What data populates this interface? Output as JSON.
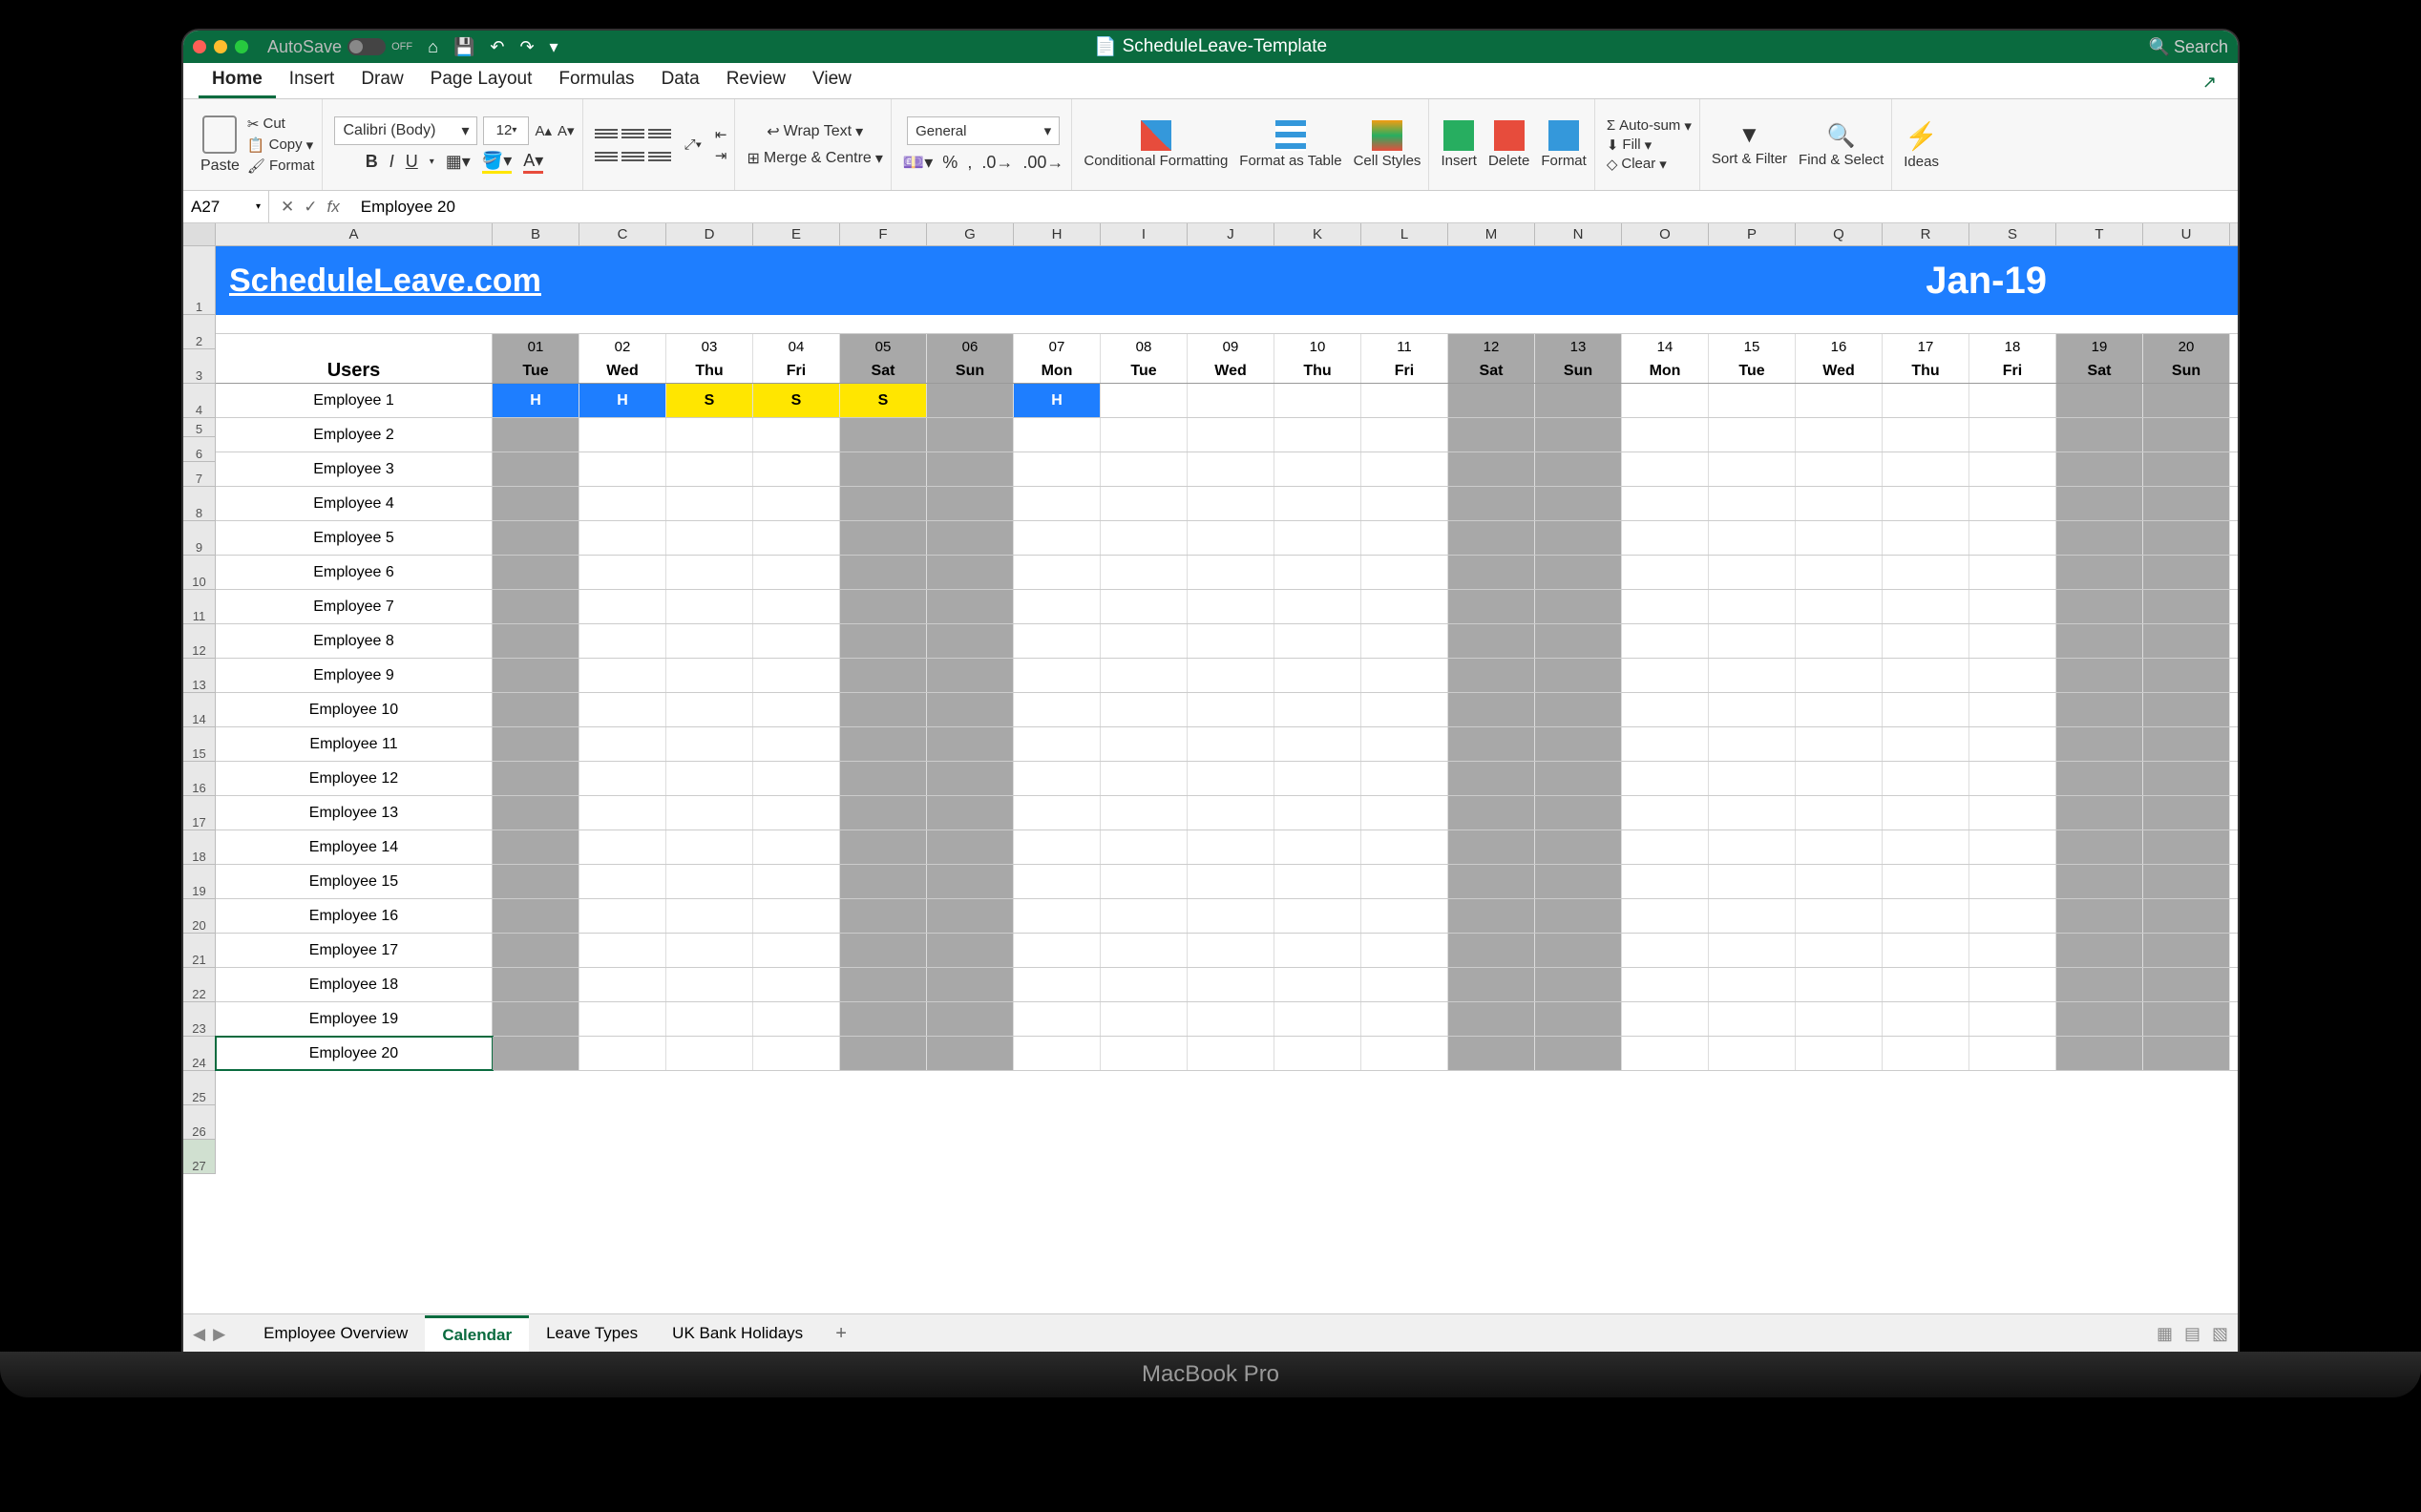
{
  "titlebar": {
    "autosave": "AutoSave",
    "autosave_state": "OFF",
    "doc": "ScheduleLeave-Template",
    "search": "Search"
  },
  "tabs": [
    "Home",
    "Insert",
    "Draw",
    "Page Layout",
    "Formulas",
    "Data",
    "Review",
    "View"
  ],
  "ribbon": {
    "paste": "Paste",
    "cut": "Cut",
    "copy": "Copy",
    "format": "Format",
    "font": "Calibri (Body)",
    "size": "12",
    "wrap": "Wrap Text",
    "merge": "Merge & Centre",
    "numfmt": "General",
    "cf": "Conditional Formatting",
    "fat": "Format as Table",
    "cs": "Cell Styles",
    "insert": "Insert",
    "delete": "Delete",
    "formatc": "Format",
    "autosum": "Auto-sum",
    "fill": "Fill",
    "clear": "Clear",
    "sort": "Sort & Filter",
    "find": "Find & Select",
    "ideas": "Ideas"
  },
  "formula": {
    "cell": "A27",
    "value": "Employee 20"
  },
  "cols": [
    "A",
    "B",
    "C",
    "D",
    "E",
    "F",
    "G",
    "H",
    "I",
    "J",
    "K",
    "L",
    "M",
    "N",
    "O",
    "P",
    "Q",
    "R",
    "S",
    "T",
    "U"
  ],
  "banner": {
    "brand": "ScheduleLeave.com",
    "month": "Jan-19"
  },
  "days": [
    {
      "n": "01",
      "d": "Tue",
      "w": true
    },
    {
      "n": "02",
      "d": "Wed"
    },
    {
      "n": "03",
      "d": "Thu"
    },
    {
      "n": "04",
      "d": "Fri"
    },
    {
      "n": "05",
      "d": "Sat",
      "w": true
    },
    {
      "n": "06",
      "d": "Sun",
      "w": true
    },
    {
      "n": "07",
      "d": "Mon"
    },
    {
      "n": "08",
      "d": "Tue"
    },
    {
      "n": "09",
      "d": "Wed"
    },
    {
      "n": "10",
      "d": "Thu"
    },
    {
      "n": "11",
      "d": "Fri"
    },
    {
      "n": "12",
      "d": "Sat",
      "w": true
    },
    {
      "n": "13",
      "d": "Sun",
      "w": true
    },
    {
      "n": "14",
      "d": "Mon"
    },
    {
      "n": "15",
      "d": "Tue"
    },
    {
      "n": "16",
      "d": "Wed"
    },
    {
      "n": "17",
      "d": "Thu"
    },
    {
      "n": "18",
      "d": "Fri"
    },
    {
      "n": "19",
      "d": "Sat",
      "w": true
    },
    {
      "n": "20",
      "d": "Sun",
      "w": true
    }
  ],
  "users_label": "Users",
  "employees": [
    {
      "name": "Employee 1",
      "leave": {
        "0": "H",
        "1": "H",
        "2": "S",
        "3": "S",
        "4": "S",
        "6": "H"
      }
    },
    {
      "name": "Employee 2"
    },
    {
      "name": "Employee 3"
    },
    {
      "name": "Employee 4"
    },
    {
      "name": "Employee 5"
    },
    {
      "name": "Employee 6"
    },
    {
      "name": "Employee 7"
    },
    {
      "name": "Employee 8"
    },
    {
      "name": "Employee 9"
    },
    {
      "name": "Employee 10"
    },
    {
      "name": "Employee 11"
    },
    {
      "name": "Employee 12"
    },
    {
      "name": "Employee 13"
    },
    {
      "name": "Employee 14"
    },
    {
      "name": "Employee 15"
    },
    {
      "name": "Employee 16"
    },
    {
      "name": "Employee 17"
    },
    {
      "name": "Employee 18"
    },
    {
      "name": "Employee 19"
    },
    {
      "name": "Employee 20"
    }
  ],
  "row_nums_start": 1,
  "selected_row": 27,
  "sheets": [
    "Employee Overview",
    "Calendar",
    "Leave Types",
    "UK Bank Holidays"
  ],
  "active_sheet": 1,
  "laptop": "MacBook Pro",
  "chart_data": {
    "type": "table",
    "title": "Jan-19 Leave Calendar",
    "columns": [
      "User",
      "01 Tue",
      "02 Wed",
      "03 Thu",
      "04 Fri",
      "05 Sat",
      "06 Sun",
      "07 Mon",
      "08 Tue",
      "09 Wed",
      "10 Thu",
      "11 Fri",
      "12 Sat",
      "13 Sun",
      "14 Mon",
      "15 Tue",
      "16 Wed",
      "17 Thu",
      "18 Fri",
      "19 Sat",
      "20 Sun"
    ],
    "rows": [
      [
        "Employee 1",
        "H",
        "H",
        "S",
        "S",
        "S",
        "",
        "H",
        "",
        "",
        "",
        "",
        "",
        "",
        "",
        "",
        "",
        "",
        "",
        "",
        ""
      ],
      [
        "Employee 2",
        "",
        "",
        "",
        "",
        "",
        "",
        "",
        "",
        "",
        "",
        "",
        "",
        "",
        "",
        "",
        "",
        "",
        "",
        "",
        ""
      ],
      [
        "Employee 3",
        "",
        "",
        "",
        "",
        "",
        "",
        "",
        "",
        "",
        "",
        "",
        "",
        "",
        "",
        "",
        "",
        "",
        "",
        "",
        ""
      ],
      [
        "Employee 4",
        "",
        "",
        "",
        "",
        "",
        "",
        "",
        "",
        "",
        "",
        "",
        "",
        "",
        "",
        "",
        "",
        "",
        "",
        "",
        ""
      ],
      [
        "Employee 5",
        "",
        "",
        "",
        "",
        "",
        "",
        "",
        "",
        "",
        "",
        "",
        "",
        "",
        "",
        "",
        "",
        "",
        "",
        "",
        ""
      ],
      [
        "Employee 6",
        "",
        "",
        "",
        "",
        "",
        "",
        "",
        "",
        "",
        "",
        "",
        "",
        "",
        "",
        "",
        "",
        "",
        "",
        "",
        ""
      ],
      [
        "Employee 7",
        "",
        "",
        "",
        "",
        "",
        "",
        "",
        "",
        "",
        "",
        "",
        "",
        "",
        "",
        "",
        "",
        "",
        "",
        "",
        ""
      ],
      [
        "Employee 8",
        "",
        "",
        "",
        "",
        "",
        "",
        "",
        "",
        "",
        "",
        "",
        "",
        "",
        "",
        "",
        "",
        "",
        "",
        "",
        ""
      ],
      [
        "Employee 9",
        "",
        "",
        "",
        "",
        "",
        "",
        "",
        "",
        "",
        "",
        "",
        "",
        "",
        "",
        "",
        "",
        "",
        "",
        "",
        ""
      ],
      [
        "Employee 10",
        "",
        "",
        "",
        "",
        "",
        "",
        "",
        "",
        "",
        "",
        "",
        "",
        "",
        "",
        "",
        "",
        "",
        "",
        "",
        ""
      ],
      [
        "Employee 11",
        "",
        "",
        "",
        "",
        "",
        "",
        "",
        "",
        "",
        "",
        "",
        "",
        "",
        "",
        "",
        "",
        "",
        "",
        "",
        ""
      ],
      [
        "Employee 12",
        "",
        "",
        "",
        "",
        "",
        "",
        "",
        "",
        "",
        "",
        "",
        "",
        "",
        "",
        "",
        "",
        "",
        "",
        "",
        ""
      ],
      [
        "Employee 13",
        "",
        "",
        "",
        "",
        "",
        "",
        "",
        "",
        "",
        "",
        "",
        "",
        "",
        "",
        "",
        "",
        "",
        "",
        "",
        ""
      ],
      [
        "Employee 14",
        "",
        "",
        "",
        "",
        "",
        "",
        "",
        "",
        "",
        "",
        "",
        "",
        "",
        "",
        "",
        "",
        "",
        "",
        "",
        ""
      ],
      [
        "Employee 15",
        "",
        "",
        "",
        "",
        "",
        "",
        "",
        "",
        "",
        "",
        "",
        "",
        "",
        "",
        "",
        "",
        "",
        "",
        "",
        ""
      ],
      [
        "Employee 16",
        "",
        "",
        "",
        "",
        "",
        "",
        "",
        "",
        "",
        "",
        "",
        "",
        "",
        "",
        "",
        "",
        "",
        "",
        "",
        ""
      ],
      [
        "Employee 17",
        "",
        "",
        "",
        "",
        "",
        "",
        "",
        "",
        "",
        "",
        "",
        "",
        "",
        "",
        "",
        "",
        "",
        "",
        "",
        ""
      ],
      [
        "Employee 18",
        "",
        "",
        "",
        "",
        "",
        "",
        "",
        "",
        "",
        "",
        "",
        "",
        "",
        "",
        "",
        "",
        "",
        "",
        "",
        ""
      ],
      [
        "Employee 19",
        "",
        "",
        "",
        "",
        "",
        "",
        "",
        "",
        "",
        "",
        "",
        "",
        "",
        "",
        "",
        "",
        "",
        "",
        "",
        ""
      ],
      [
        "Employee 20",
        "",
        "",
        "",
        "",
        "",
        "",
        "",
        "",
        "",
        "",
        "",
        "",
        "",
        "",
        "",
        "",
        "",
        "",
        "",
        ""
      ]
    ]
  }
}
